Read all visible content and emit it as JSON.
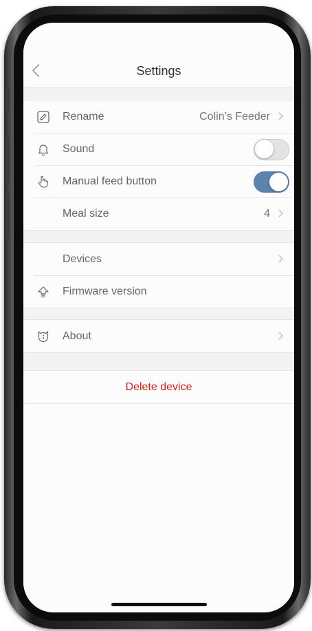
{
  "header": {
    "title": "Settings",
    "back_icon": "chevron-left-icon"
  },
  "groups": [
    {
      "rows": [
        {
          "icon": "pencil-icon",
          "label": "Rename",
          "value": "Colin’s Feeder",
          "chevron": true
        },
        {
          "icon": "bell-icon",
          "label": "Sound",
          "toggle": false
        },
        {
          "icon": "hand-pointer-icon",
          "label": "Manual feed button",
          "toggle": true
        },
        {
          "icon": "",
          "label": "Meal size",
          "value": "4",
          "chevron": true
        }
      ]
    },
    {
      "rows": [
        {
          "icon": "",
          "label": "Devices",
          "chevron": true
        },
        {
          "icon": "firmware-upload-icon",
          "label": "Firmware version"
        }
      ]
    },
    {
      "rows": [
        {
          "icon": "cat-info-icon",
          "label": "About",
          "chevron": true
        }
      ]
    }
  ],
  "delete": {
    "label": "Delete device"
  },
  "colors": {
    "toggle_on": "#5b83ad",
    "delete_text": "#c8201f",
    "background": "#f3f3f4"
  }
}
